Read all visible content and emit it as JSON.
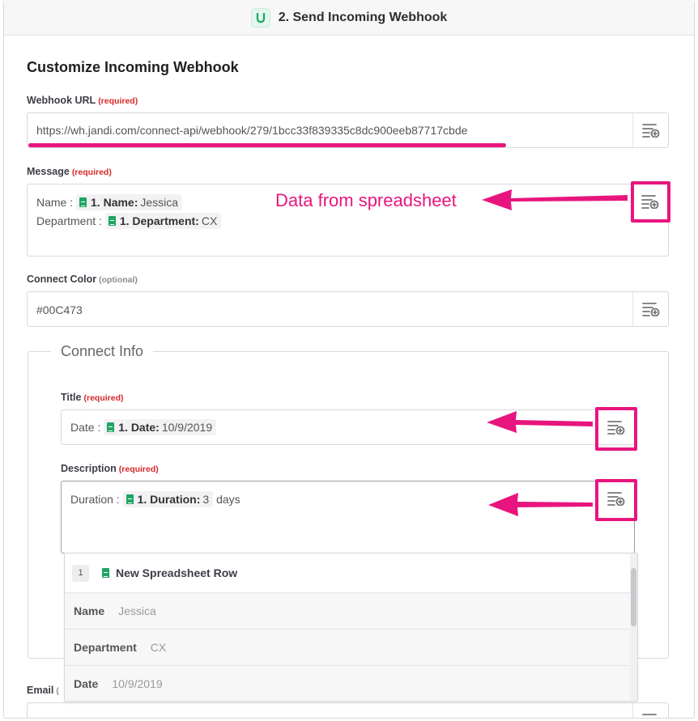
{
  "header": {
    "title": "2. Send Incoming Webhook",
    "app_icon": "jandi-icon",
    "accent": "#1fa463"
  },
  "section_title": "Customize Incoming Webhook",
  "webhook_url": {
    "label": "Webhook URL",
    "badge": "(required)",
    "value": "https://wh.jandi.com/connect-api/webhook/279/1bcc33f839335c8dc900eeb87717cbde"
  },
  "message": {
    "label": "Message",
    "badge": "(required)",
    "lines": [
      {
        "prefix": "Name :",
        "pill_key": "1. Name:",
        "pill_value": "Jessica"
      },
      {
        "prefix": "Department :",
        "pill_key": "1. Department:",
        "pill_value": "CX"
      }
    ]
  },
  "connect_color": {
    "label": "Connect Color",
    "badge": "(optional)",
    "value": "#00C473"
  },
  "connect_info": {
    "legend": "Connect Info",
    "title": {
      "label": "Title",
      "badge": "(required)",
      "prefix": "Date :",
      "pill_key": "1. Date:",
      "pill_value": "10/9/2019"
    },
    "description": {
      "label": "Description",
      "badge": "(required)",
      "prefix": "Duration :",
      "pill_key": "1. Duration:",
      "pill_value": "3",
      "suffix": "days"
    }
  },
  "dropdown": {
    "step": "1",
    "title": "New Spreadsheet Row",
    "rows": [
      {
        "key": "Name",
        "value": "Jessica"
      },
      {
        "key": "Department",
        "value": "CX"
      },
      {
        "key": "Date",
        "value": "10/9/2019"
      }
    ]
  },
  "email": {
    "label": "Email",
    "badge": "("
  },
  "annotation": {
    "text": "Data from spreadsheet",
    "color": "#e8157f"
  }
}
